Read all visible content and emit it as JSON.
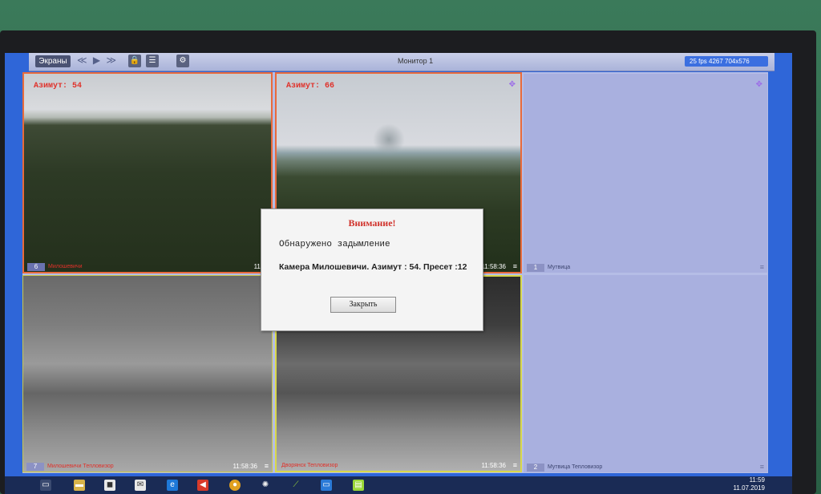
{
  "toolbar": {
    "screens_label": "Экраны",
    "nav_glyphs": "≪ ▶ ≫",
    "title": "Монитор 1",
    "stats": "25 fps   4267 704x576"
  },
  "cameras": [
    {
      "azimuth": "Азимут: 54",
      "number": "6",
      "name": "Милошевичи",
      "time": "11:58"
    },
    {
      "azimuth": "Азимут: 66",
      "number": "",
      "name": "",
      "time": "11:58:36"
    },
    {
      "azimuth": "",
      "number": "1",
      "name": "Мутвица",
      "time": ""
    },
    {
      "azimuth": "",
      "number": "7",
      "name": "Милошевичи Тепловизор",
      "time": "11:58:36"
    },
    {
      "azimuth": "",
      "number": "",
      "name": "Дворянск Тепловизор",
      "time": "11:58:36"
    },
    {
      "azimuth": "",
      "number": "2",
      "name": "Мутвица Тепловизор",
      "time": ""
    }
  ],
  "dialog": {
    "title": "Внимание!",
    "message": "Обнаружено задымление",
    "detail": "Камера Милошевичи. Азимут : 54. Пресет :12",
    "close_label": "Закрыть"
  },
  "taskbar": {
    "time": "11:59",
    "date": "11.07.2019"
  },
  "colors": {
    "alert_red": "#d0312a",
    "accent_blue": "#2f66d8"
  }
}
